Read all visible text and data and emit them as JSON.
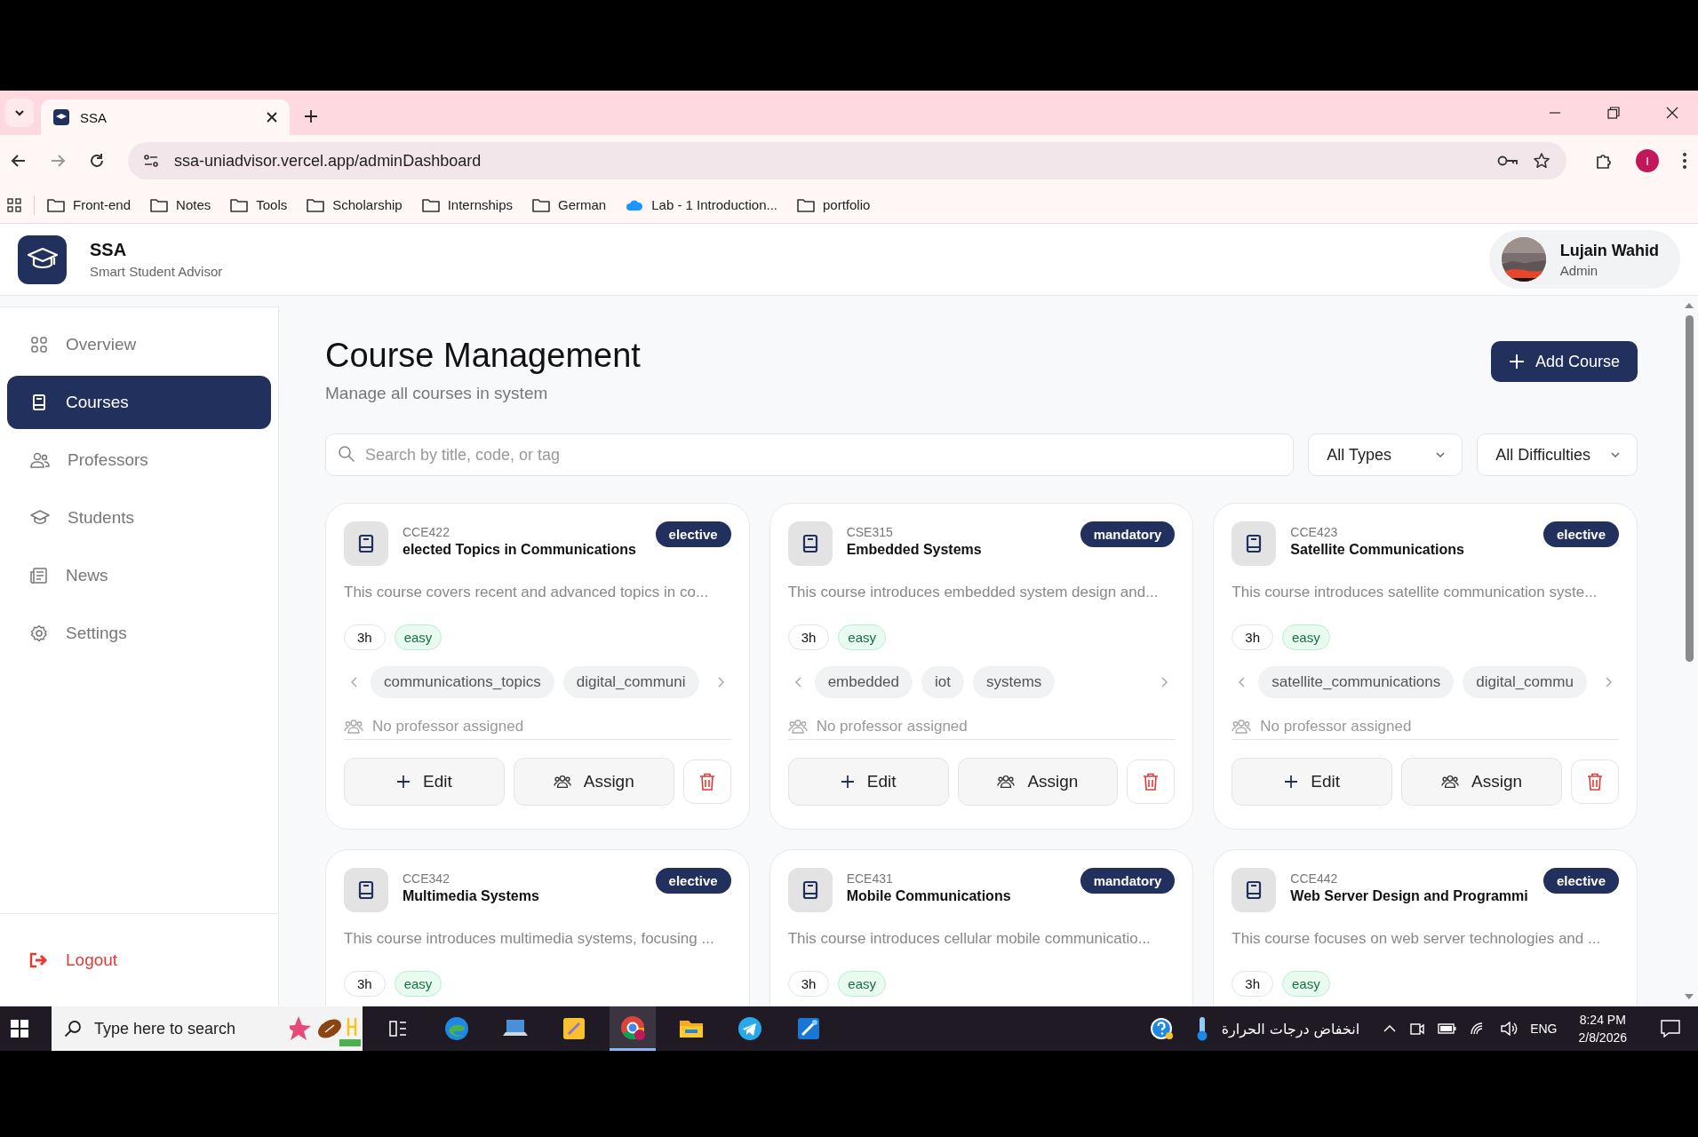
{
  "browser": {
    "tabs": [
      {
        "title": "SSA",
        "selected": true
      }
    ],
    "url": "ssa-uniadvisor.vercel.app/adminDashboard",
    "profile_initial": "I",
    "bookmarks": [
      {
        "label": "Front-end",
        "kind": "folder"
      },
      {
        "label": "Notes",
        "kind": "folder"
      },
      {
        "label": "Tools",
        "kind": "folder"
      },
      {
        "label": "Scholarship",
        "kind": "folder"
      },
      {
        "label": "Internships",
        "kind": "folder"
      },
      {
        "label": "German",
        "kind": "folder"
      },
      {
        "label": "Lab - 1 Introduction...",
        "kind": "cloud"
      },
      {
        "label": "portfolio",
        "kind": "folder"
      }
    ]
  },
  "app": {
    "brand": "SSA",
    "subtitle": "Smart Student Advisor",
    "user": {
      "name": "Lujain Wahid",
      "role": "Admin"
    }
  },
  "sidebar": {
    "items": [
      {
        "label": "Overview",
        "kind": "grid",
        "selected": false
      },
      {
        "label": "Courses",
        "kind": "book",
        "selected": true
      },
      {
        "label": "Professors",
        "kind": "people",
        "selected": false
      },
      {
        "label": "Students",
        "kind": "cap",
        "selected": false
      },
      {
        "label": "News",
        "kind": "news",
        "selected": false
      },
      {
        "label": "Settings",
        "kind": "gear",
        "selected": false
      }
    ],
    "logout": "Logout"
  },
  "page": {
    "title": "Course Management",
    "subtitle": "Manage all courses in system",
    "add_button": "Add Course",
    "search": {
      "placeholder": "Search by title, code, or tag"
    },
    "filters": [
      "All Types",
      "All Difficulties"
    ]
  },
  "courses": [
    {
      "code": "CCE422",
      "title": "elected Topics in Communications",
      "type": "elective",
      "description": "This course covers recent and advanced topics in co...",
      "hours": "3h",
      "difficulty": "easy",
      "tags": [
        "communications_topics",
        "digital_communi"
      ],
      "professor": "No professor assigned",
      "actions": [
        "Edit",
        "Assign"
      ]
    },
    {
      "code": "CSE315",
      "title": "Embedded Systems",
      "type": "mandatory",
      "description": "This course introduces embedded system design and...",
      "hours": "3h",
      "difficulty": "easy",
      "tags": [
        "embedded",
        "iot",
        "systems"
      ],
      "professor": "No professor assigned",
      "actions": [
        "Edit",
        "Assign"
      ]
    },
    {
      "code": "CCE423",
      "title": "Satellite Communications",
      "type": "elective",
      "description": "This course introduces satellite communication syste...",
      "hours": "3h",
      "difficulty": "easy",
      "tags": [
        "satellite_communications",
        "digital_commu"
      ],
      "professor": "No professor assigned",
      "actions": [
        "Edit",
        "Assign"
      ]
    },
    {
      "code": "CCE342",
      "title": "Multimedia Systems",
      "type": "elective",
      "description": "This course introduces multimedia systems, focusing ...",
      "hours": "3h",
      "difficulty": "easy"
    },
    {
      "code": "ECE431",
      "title": "Mobile Communications",
      "type": "mandatory",
      "description": "This course introduces cellular mobile communicatio...",
      "hours": "3h",
      "difficulty": "easy"
    },
    {
      "code": "CCE442",
      "title": "Web Server Design and Programmi",
      "type": "elective",
      "description": "This course focuses on web server technologies and ...",
      "hours": "3h",
      "difficulty": "easy"
    }
  ],
  "taskbar": {
    "search_placeholder": "Type here to search",
    "apps": [
      {
        "kind": "taskview",
        "selected": false
      },
      {
        "kind": "edge",
        "selected": false
      },
      {
        "kind": "laptop",
        "selected": false
      },
      {
        "kind": "notes",
        "selected": false
      },
      {
        "kind": "chrome",
        "selected": true
      },
      {
        "kind": "folder",
        "selected": false
      },
      {
        "kind": "telegram",
        "selected": false
      },
      {
        "kind": "app",
        "selected": false
      }
    ],
    "weather": "انخفاض درجات الحرارة",
    "language": "ENG",
    "time": "8:24 PM",
    "date": "2/8/2026"
  }
}
